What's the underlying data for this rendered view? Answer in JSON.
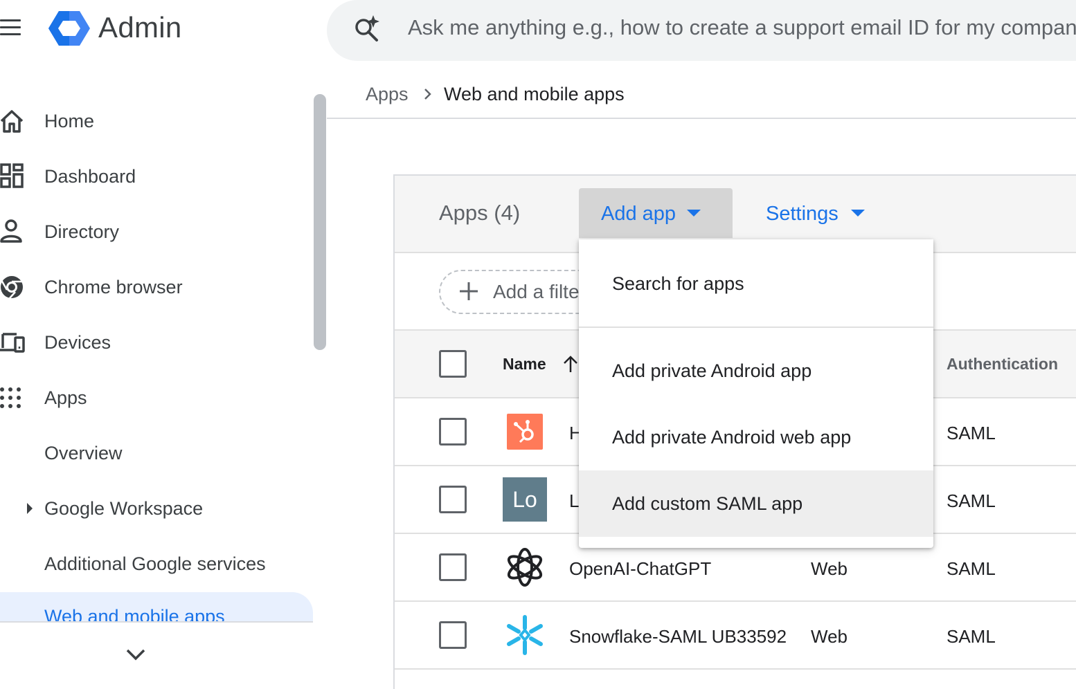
{
  "header": {
    "brand": "Admin",
    "search_placeholder": "Ask me anything e.g., how to create a support email ID for my company",
    "logo_colors": [
      "#4285f4",
      "#1a73e8",
      "#ffffff"
    ]
  },
  "sidebar": {
    "items": [
      {
        "label": "Home",
        "icon": "home-icon"
      },
      {
        "label": "Dashboard",
        "icon": "dashboard-icon"
      },
      {
        "label": "Directory",
        "icon": "person-icon"
      },
      {
        "label": "Chrome browser",
        "icon": "chrome-icon"
      },
      {
        "label": "Devices",
        "icon": "devices-icon"
      },
      {
        "label": "Apps",
        "icon": "apps-grid-icon"
      }
    ],
    "sub_items": [
      {
        "label": "Overview"
      },
      {
        "label": "Google Workspace"
      },
      {
        "label": "Additional Google services"
      }
    ],
    "active_item": "Web and mobile apps"
  },
  "breadcrumb": {
    "parent": "Apps",
    "current": "Web and mobile apps"
  },
  "card": {
    "title": "Apps (4)",
    "add_app_label": "Add app",
    "settings_label": "Settings",
    "filter_label": "Add a filter"
  },
  "table": {
    "columns": {
      "name": "Name",
      "authentication": "Authentication"
    },
    "rows": [
      {
        "name": "H",
        "type": "",
        "auth": "SAML",
        "logo": "hubspot-logo"
      },
      {
        "name": "L",
        "type": "",
        "auth": "SAML",
        "logo": "lo-logo",
        "logo_text": "Lo"
      },
      {
        "name": "OpenAI-ChatGPT",
        "type": "Web",
        "auth": "SAML",
        "logo": "openai-logo"
      },
      {
        "name": "Snowflake-SAML UB33592",
        "type": "Web",
        "auth": "SAML",
        "logo": "snowflake-logo"
      }
    ]
  },
  "dropdown": {
    "items": [
      {
        "label": "Search for apps"
      },
      {
        "label": "Add private Android app"
      },
      {
        "label": "Add private Android web app"
      },
      {
        "label": "Add custom SAML app"
      }
    ],
    "highlighted": "Add custom SAML app"
  },
  "colors": {
    "accent": "#1a73e8",
    "active_nav_bg": "#e8f0fe",
    "hubspot": "#ff7a59",
    "snowflake": "#29b5e8"
  }
}
